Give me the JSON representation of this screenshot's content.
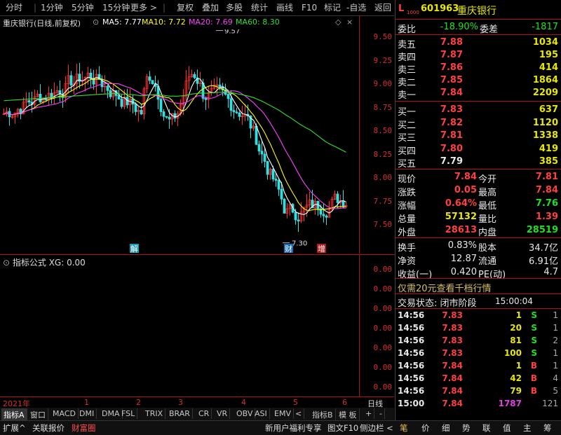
{
  "toolbar": {
    "left": [
      "分时",
      "1分钟",
      "5分钟",
      "15分钟",
      "更多 >"
    ],
    "right": [
      "复权",
      "叠加",
      "多股",
      "统计",
      "画线",
      "F10",
      "标记",
      "-自选",
      "返回"
    ]
  },
  "chart": {
    "title": "重庆银行(日线,前复权)",
    "ma5": "MA5: 7.77",
    "ma10": "MA10: 7.72",
    "ma20": "MA20: 7.69",
    "ma60": "MA60: 8.30",
    "high_label": "9.57",
    "low_label": "7.30",
    "markers": [
      "解",
      "财",
      "增"
    ],
    "price_ticks": [
      "9.50",
      "9.25",
      "9.00",
      "8.75",
      "8.50",
      "8.25",
      "8.00",
      "7.75",
      "7.50"
    ],
    "colors": {
      "ma5": "#ffffff",
      "ma10": "#ffff00",
      "ma20": "#ff40ff",
      "ma60": "#30e030",
      "up": "#ff3030",
      "down": "#30e0e0"
    }
  },
  "indicator": {
    "title": "指标公式 XG: 0.00",
    "ticks": [
      "0.00",
      "0.00",
      "0.00",
      "0.00",
      "0.00",
      "0.00",
      "0.00"
    ]
  },
  "time_axis": {
    "year": "2021年",
    "months": [
      "1",
      "2",
      "3",
      "4",
      "5",
      "6"
    ],
    "period": "日线"
  },
  "tabs": [
    "指标A",
    "窗口",
    "MACD",
    "DMI",
    "DMA",
    "FSL",
    "TRIX",
    "BRAR",
    "CR",
    "VR",
    "OBV",
    "ASI",
    "EMV",
    "<"
  ],
  "tabs_right": [
    "指标B",
    "模 板",
    "+",
    "-"
  ],
  "status": {
    "left": [
      "扩展^",
      "关联报价",
      "财富圈"
    ],
    "mid": [
      "新用户福利专享",
      "图文F10",
      "侧边栏 <"
    ],
    "right": [
      "笔",
      "价",
      "细",
      "势",
      "联",
      "值",
      "主",
      "筹"
    ]
  },
  "quote": {
    "code": "601963",
    "name": "重庆银行",
    "weibi_label": "委比",
    "weibi": "-18.90%",
    "weicha_label": "委差",
    "weicha": "-1817",
    "asks": [
      {
        "label": "卖五",
        "price": "7.88",
        "vol": "1034"
      },
      {
        "label": "卖四",
        "price": "7.87",
        "vol": "195"
      },
      {
        "label": "卖三",
        "price": "7.86",
        "vol": "414"
      },
      {
        "label": "卖二",
        "price": "7.85",
        "vol": "1864"
      },
      {
        "label": "卖一",
        "price": "7.84",
        "vol": "2209"
      }
    ],
    "bids": [
      {
        "label": "买一",
        "price": "7.83",
        "vol": "637"
      },
      {
        "label": "买二",
        "price": "7.82",
        "vol": "1120"
      },
      {
        "label": "买三",
        "price": "7.81",
        "vol": "1338"
      },
      {
        "label": "买四",
        "price": "7.80",
        "vol": "419"
      },
      {
        "label": "买五",
        "price": "7.79",
        "vol": "385"
      }
    ],
    "stats": [
      {
        "l1": "现价",
        "v1": "7.84",
        "l2": "今开",
        "v2": "7.81"
      },
      {
        "l1": "涨跌",
        "v1": "0.05",
        "l2": "最高",
        "v2": "7.84"
      },
      {
        "l1": "涨幅",
        "v1": "0.64%",
        "l2": "最低",
        "v2": "7.76"
      },
      {
        "l1": "总量",
        "v1": "57132",
        "l2": "量比",
        "v2": "1.39"
      },
      {
        "l1": "外盘",
        "v1": "28613",
        "l2": "内盘",
        "v2": "28519"
      }
    ],
    "stats2": [
      {
        "l1": "换手",
        "v1": "0.83%",
        "l2": "股本",
        "v2": "34.7亿"
      },
      {
        "l1": "净资",
        "v1": "12.87",
        "l2": "流通",
        "v2": "6.91亿"
      },
      {
        "l1": "收益(一)",
        "v1": "0.420",
        "l2": "PE(动)",
        "v2": "4.7"
      }
    ],
    "promo": "仅需20元查看千档行情",
    "trade_state_label": "交易状态: 闭市阶段",
    "trade_state_time": "15:00:04",
    "ticks": [
      {
        "t": "14:56",
        "p": "7.83",
        "v": "1",
        "s": "S",
        "n": "1"
      },
      {
        "t": "14:56",
        "p": "7.83",
        "v": "20",
        "s": "S",
        "n": "1"
      },
      {
        "t": "14:56",
        "p": "7.83",
        "v": "81",
        "s": "S",
        "n": "2"
      },
      {
        "t": "14:56",
        "p": "7.83",
        "v": "100",
        "s": "S",
        "n": "1"
      },
      {
        "t": "14:56",
        "p": "7.84",
        "v": "1",
        "s": "B",
        "n": "1"
      },
      {
        "t": "14:56",
        "p": "7.84",
        "v": "42",
        "s": "B",
        "n": "4"
      },
      {
        "t": "14:56",
        "p": "7.84",
        "v": "79",
        "s": "B",
        "n": "5"
      },
      {
        "t": "15:00",
        "p": "7.84",
        "v": "1787",
        "s": "",
        "n": "121"
      }
    ]
  }
}
